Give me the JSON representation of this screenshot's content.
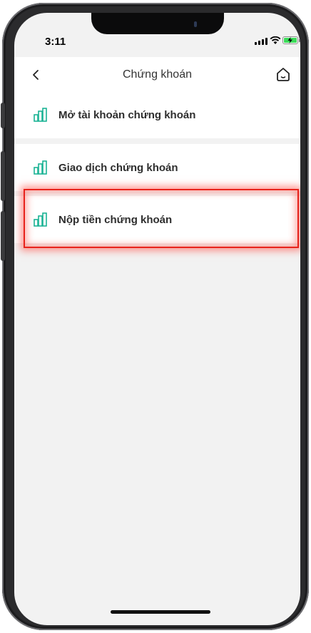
{
  "status_bar": {
    "time": "3:11"
  },
  "header": {
    "title": "Chứng khoán",
    "back_icon": "chevron-left-icon",
    "home_icon": "home-icon"
  },
  "menu": {
    "items": [
      {
        "label": "Mở tài khoản chứng khoán",
        "icon": "bar-chart-icon"
      },
      {
        "label": "Giao dịch chứng khoán",
        "icon": "bar-chart-icon"
      },
      {
        "label": "Nộp tiền chứng khoán",
        "icon": "bar-chart-icon",
        "highlighted": true
      }
    ]
  },
  "colors": {
    "accent_icon": "#1bb394",
    "highlight": "#e8231c",
    "background": "#f2f2f2",
    "battery_fill": "#3ddc5a"
  }
}
